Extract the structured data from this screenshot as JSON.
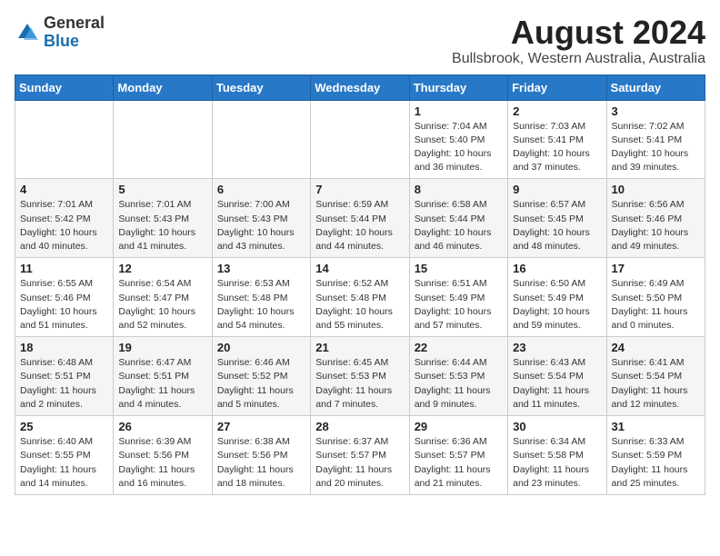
{
  "header": {
    "logo_general": "General",
    "logo_blue": "Blue",
    "title": "August 2024",
    "subtitle": "Bullsbrook, Western Australia, Australia"
  },
  "days_of_week": [
    "Sunday",
    "Monday",
    "Tuesday",
    "Wednesday",
    "Thursday",
    "Friday",
    "Saturday"
  ],
  "weeks": [
    [
      {
        "day": "",
        "info": ""
      },
      {
        "day": "",
        "info": ""
      },
      {
        "day": "",
        "info": ""
      },
      {
        "day": "",
        "info": ""
      },
      {
        "day": "1",
        "info": "Sunrise: 7:04 AM\nSunset: 5:40 PM\nDaylight: 10 hours\nand 36 minutes."
      },
      {
        "day": "2",
        "info": "Sunrise: 7:03 AM\nSunset: 5:41 PM\nDaylight: 10 hours\nand 37 minutes."
      },
      {
        "day": "3",
        "info": "Sunrise: 7:02 AM\nSunset: 5:41 PM\nDaylight: 10 hours\nand 39 minutes."
      }
    ],
    [
      {
        "day": "4",
        "info": "Sunrise: 7:01 AM\nSunset: 5:42 PM\nDaylight: 10 hours\nand 40 minutes."
      },
      {
        "day": "5",
        "info": "Sunrise: 7:01 AM\nSunset: 5:43 PM\nDaylight: 10 hours\nand 41 minutes."
      },
      {
        "day": "6",
        "info": "Sunrise: 7:00 AM\nSunset: 5:43 PM\nDaylight: 10 hours\nand 43 minutes."
      },
      {
        "day": "7",
        "info": "Sunrise: 6:59 AM\nSunset: 5:44 PM\nDaylight: 10 hours\nand 44 minutes."
      },
      {
        "day": "8",
        "info": "Sunrise: 6:58 AM\nSunset: 5:44 PM\nDaylight: 10 hours\nand 46 minutes."
      },
      {
        "day": "9",
        "info": "Sunrise: 6:57 AM\nSunset: 5:45 PM\nDaylight: 10 hours\nand 48 minutes."
      },
      {
        "day": "10",
        "info": "Sunrise: 6:56 AM\nSunset: 5:46 PM\nDaylight: 10 hours\nand 49 minutes."
      }
    ],
    [
      {
        "day": "11",
        "info": "Sunrise: 6:55 AM\nSunset: 5:46 PM\nDaylight: 10 hours\nand 51 minutes."
      },
      {
        "day": "12",
        "info": "Sunrise: 6:54 AM\nSunset: 5:47 PM\nDaylight: 10 hours\nand 52 minutes."
      },
      {
        "day": "13",
        "info": "Sunrise: 6:53 AM\nSunset: 5:48 PM\nDaylight: 10 hours\nand 54 minutes."
      },
      {
        "day": "14",
        "info": "Sunrise: 6:52 AM\nSunset: 5:48 PM\nDaylight: 10 hours\nand 55 minutes."
      },
      {
        "day": "15",
        "info": "Sunrise: 6:51 AM\nSunset: 5:49 PM\nDaylight: 10 hours\nand 57 minutes."
      },
      {
        "day": "16",
        "info": "Sunrise: 6:50 AM\nSunset: 5:49 PM\nDaylight: 10 hours\nand 59 minutes."
      },
      {
        "day": "17",
        "info": "Sunrise: 6:49 AM\nSunset: 5:50 PM\nDaylight: 11 hours\nand 0 minutes."
      }
    ],
    [
      {
        "day": "18",
        "info": "Sunrise: 6:48 AM\nSunset: 5:51 PM\nDaylight: 11 hours\nand 2 minutes."
      },
      {
        "day": "19",
        "info": "Sunrise: 6:47 AM\nSunset: 5:51 PM\nDaylight: 11 hours\nand 4 minutes."
      },
      {
        "day": "20",
        "info": "Sunrise: 6:46 AM\nSunset: 5:52 PM\nDaylight: 11 hours\nand 5 minutes."
      },
      {
        "day": "21",
        "info": "Sunrise: 6:45 AM\nSunset: 5:53 PM\nDaylight: 11 hours\nand 7 minutes."
      },
      {
        "day": "22",
        "info": "Sunrise: 6:44 AM\nSunset: 5:53 PM\nDaylight: 11 hours\nand 9 minutes."
      },
      {
        "day": "23",
        "info": "Sunrise: 6:43 AM\nSunset: 5:54 PM\nDaylight: 11 hours\nand 11 minutes."
      },
      {
        "day": "24",
        "info": "Sunrise: 6:41 AM\nSunset: 5:54 PM\nDaylight: 11 hours\nand 12 minutes."
      }
    ],
    [
      {
        "day": "25",
        "info": "Sunrise: 6:40 AM\nSunset: 5:55 PM\nDaylight: 11 hours\nand 14 minutes."
      },
      {
        "day": "26",
        "info": "Sunrise: 6:39 AM\nSunset: 5:56 PM\nDaylight: 11 hours\nand 16 minutes."
      },
      {
        "day": "27",
        "info": "Sunrise: 6:38 AM\nSunset: 5:56 PM\nDaylight: 11 hours\nand 18 minutes."
      },
      {
        "day": "28",
        "info": "Sunrise: 6:37 AM\nSunset: 5:57 PM\nDaylight: 11 hours\nand 20 minutes."
      },
      {
        "day": "29",
        "info": "Sunrise: 6:36 AM\nSunset: 5:57 PM\nDaylight: 11 hours\nand 21 minutes."
      },
      {
        "day": "30",
        "info": "Sunrise: 6:34 AM\nSunset: 5:58 PM\nDaylight: 11 hours\nand 23 minutes."
      },
      {
        "day": "31",
        "info": "Sunrise: 6:33 AM\nSunset: 5:59 PM\nDaylight: 11 hours\nand 25 minutes."
      }
    ]
  ]
}
